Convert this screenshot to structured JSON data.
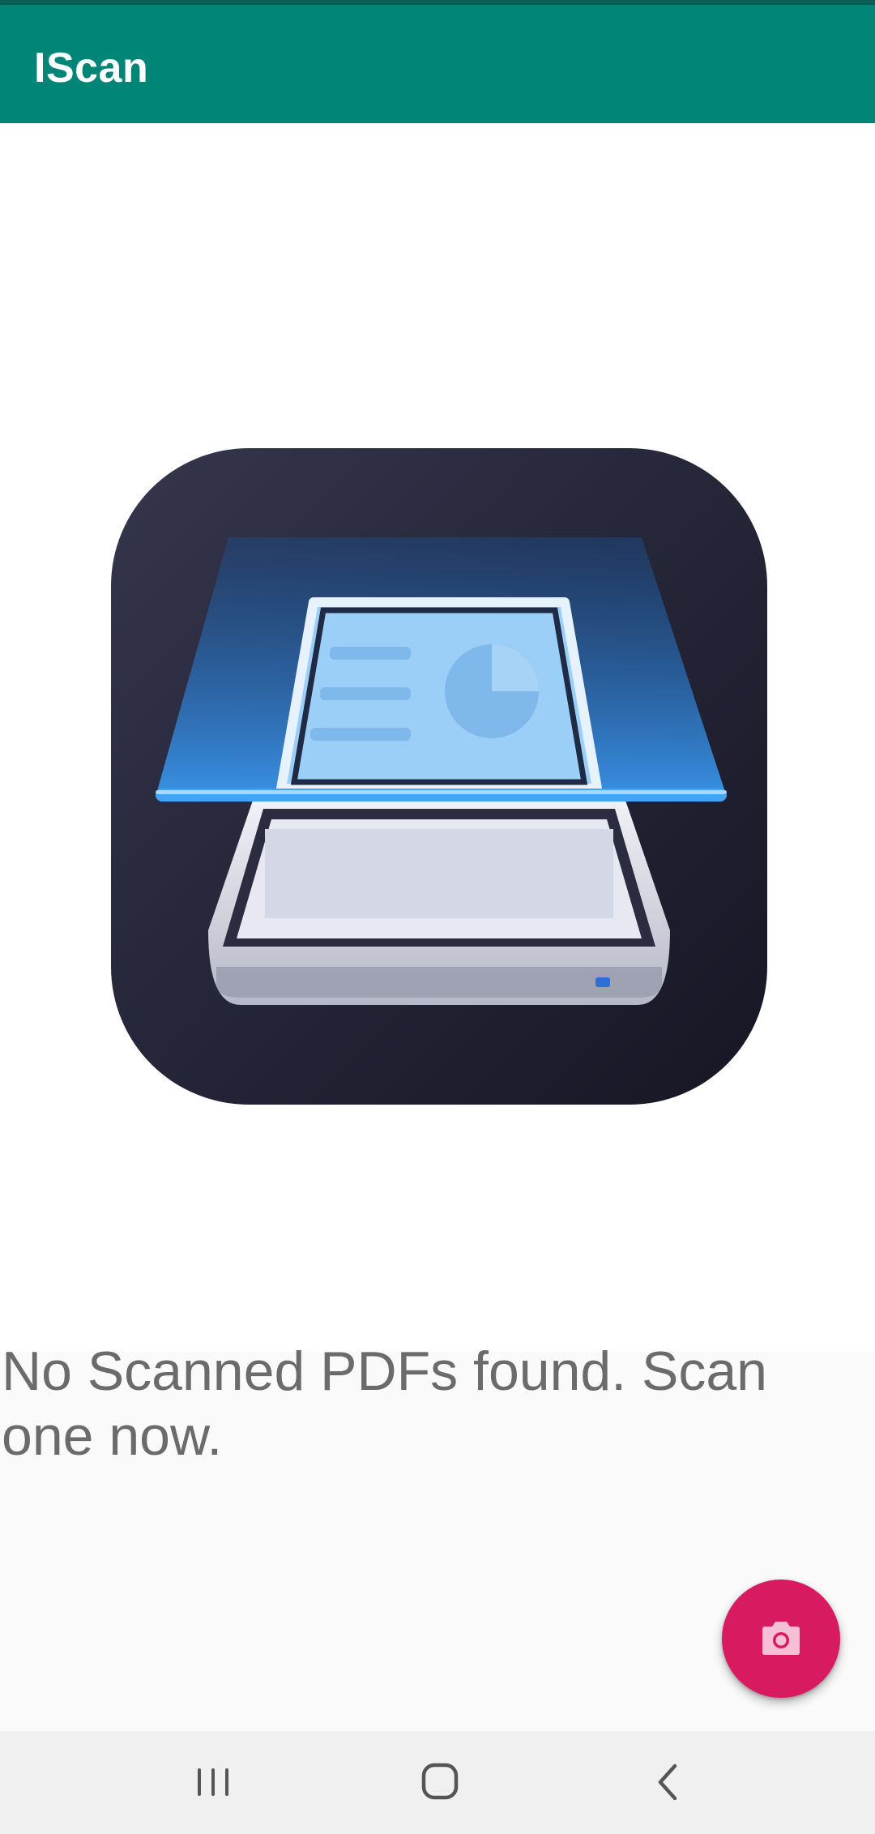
{
  "app_bar": {
    "title": "IScan",
    "background": "#008577"
  },
  "hero": {
    "icon": "document-scanner-icon"
  },
  "empty_state": {
    "message": "No Scanned PDFs found. Scan one now."
  },
  "fab": {
    "icon": "camera-icon",
    "color": "#d81b60"
  },
  "navigation": {
    "buttons": [
      {
        "icon": "recents-icon"
      },
      {
        "icon": "home-icon"
      },
      {
        "icon": "back-icon"
      }
    ]
  }
}
